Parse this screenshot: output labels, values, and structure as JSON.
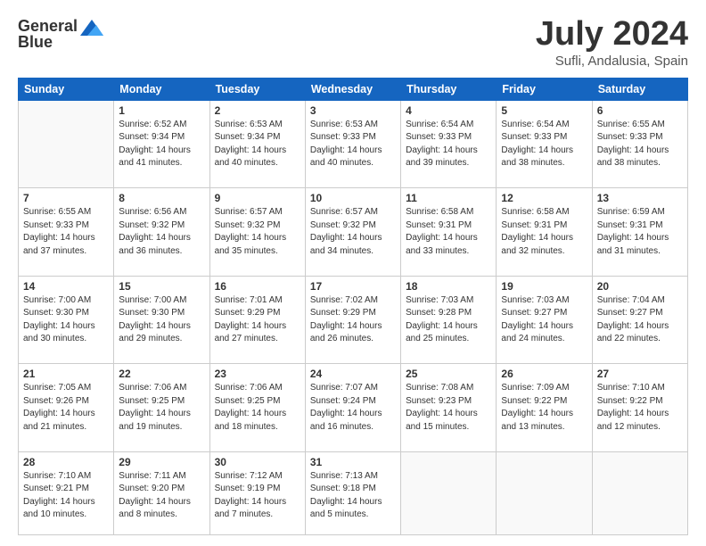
{
  "header": {
    "logo_general": "General",
    "logo_blue": "Blue",
    "month": "July 2024",
    "location": "Sufli, Andalusia, Spain"
  },
  "weekdays": [
    "Sunday",
    "Monday",
    "Tuesday",
    "Wednesday",
    "Thursday",
    "Friday",
    "Saturday"
  ],
  "weeks": [
    [
      {
        "day": "",
        "content": ""
      },
      {
        "day": "1",
        "content": "Sunrise: 6:52 AM\nSunset: 9:34 PM\nDaylight: 14 hours\nand 41 minutes."
      },
      {
        "day": "2",
        "content": "Sunrise: 6:53 AM\nSunset: 9:34 PM\nDaylight: 14 hours\nand 40 minutes."
      },
      {
        "day": "3",
        "content": "Sunrise: 6:53 AM\nSunset: 9:33 PM\nDaylight: 14 hours\nand 40 minutes."
      },
      {
        "day": "4",
        "content": "Sunrise: 6:54 AM\nSunset: 9:33 PM\nDaylight: 14 hours\nand 39 minutes."
      },
      {
        "day": "5",
        "content": "Sunrise: 6:54 AM\nSunset: 9:33 PM\nDaylight: 14 hours\nand 38 minutes."
      },
      {
        "day": "6",
        "content": "Sunrise: 6:55 AM\nSunset: 9:33 PM\nDaylight: 14 hours\nand 38 minutes."
      }
    ],
    [
      {
        "day": "7",
        "content": "Sunrise: 6:55 AM\nSunset: 9:33 PM\nDaylight: 14 hours\nand 37 minutes."
      },
      {
        "day": "8",
        "content": "Sunrise: 6:56 AM\nSunset: 9:32 PM\nDaylight: 14 hours\nand 36 minutes."
      },
      {
        "day": "9",
        "content": "Sunrise: 6:57 AM\nSunset: 9:32 PM\nDaylight: 14 hours\nand 35 minutes."
      },
      {
        "day": "10",
        "content": "Sunrise: 6:57 AM\nSunset: 9:32 PM\nDaylight: 14 hours\nand 34 minutes."
      },
      {
        "day": "11",
        "content": "Sunrise: 6:58 AM\nSunset: 9:31 PM\nDaylight: 14 hours\nand 33 minutes."
      },
      {
        "day": "12",
        "content": "Sunrise: 6:58 AM\nSunset: 9:31 PM\nDaylight: 14 hours\nand 32 minutes."
      },
      {
        "day": "13",
        "content": "Sunrise: 6:59 AM\nSunset: 9:31 PM\nDaylight: 14 hours\nand 31 minutes."
      }
    ],
    [
      {
        "day": "14",
        "content": "Sunrise: 7:00 AM\nSunset: 9:30 PM\nDaylight: 14 hours\nand 30 minutes."
      },
      {
        "day": "15",
        "content": "Sunrise: 7:00 AM\nSunset: 9:30 PM\nDaylight: 14 hours\nand 29 minutes."
      },
      {
        "day": "16",
        "content": "Sunrise: 7:01 AM\nSunset: 9:29 PM\nDaylight: 14 hours\nand 27 minutes."
      },
      {
        "day": "17",
        "content": "Sunrise: 7:02 AM\nSunset: 9:29 PM\nDaylight: 14 hours\nand 26 minutes."
      },
      {
        "day": "18",
        "content": "Sunrise: 7:03 AM\nSunset: 9:28 PM\nDaylight: 14 hours\nand 25 minutes."
      },
      {
        "day": "19",
        "content": "Sunrise: 7:03 AM\nSunset: 9:27 PM\nDaylight: 14 hours\nand 24 minutes."
      },
      {
        "day": "20",
        "content": "Sunrise: 7:04 AM\nSunset: 9:27 PM\nDaylight: 14 hours\nand 22 minutes."
      }
    ],
    [
      {
        "day": "21",
        "content": "Sunrise: 7:05 AM\nSunset: 9:26 PM\nDaylight: 14 hours\nand 21 minutes."
      },
      {
        "day": "22",
        "content": "Sunrise: 7:06 AM\nSunset: 9:25 PM\nDaylight: 14 hours\nand 19 minutes."
      },
      {
        "day": "23",
        "content": "Sunrise: 7:06 AM\nSunset: 9:25 PM\nDaylight: 14 hours\nand 18 minutes."
      },
      {
        "day": "24",
        "content": "Sunrise: 7:07 AM\nSunset: 9:24 PM\nDaylight: 14 hours\nand 16 minutes."
      },
      {
        "day": "25",
        "content": "Sunrise: 7:08 AM\nSunset: 9:23 PM\nDaylight: 14 hours\nand 15 minutes."
      },
      {
        "day": "26",
        "content": "Sunrise: 7:09 AM\nSunset: 9:22 PM\nDaylight: 14 hours\nand 13 minutes."
      },
      {
        "day": "27",
        "content": "Sunrise: 7:10 AM\nSunset: 9:22 PM\nDaylight: 14 hours\nand 12 minutes."
      }
    ],
    [
      {
        "day": "28",
        "content": "Sunrise: 7:10 AM\nSunset: 9:21 PM\nDaylight: 14 hours\nand 10 minutes."
      },
      {
        "day": "29",
        "content": "Sunrise: 7:11 AM\nSunset: 9:20 PM\nDaylight: 14 hours\nand 8 minutes."
      },
      {
        "day": "30",
        "content": "Sunrise: 7:12 AM\nSunset: 9:19 PM\nDaylight: 14 hours\nand 7 minutes."
      },
      {
        "day": "31",
        "content": "Sunrise: 7:13 AM\nSunset: 9:18 PM\nDaylight: 14 hours\nand 5 minutes."
      },
      {
        "day": "",
        "content": ""
      },
      {
        "day": "",
        "content": ""
      },
      {
        "day": "",
        "content": ""
      }
    ]
  ]
}
